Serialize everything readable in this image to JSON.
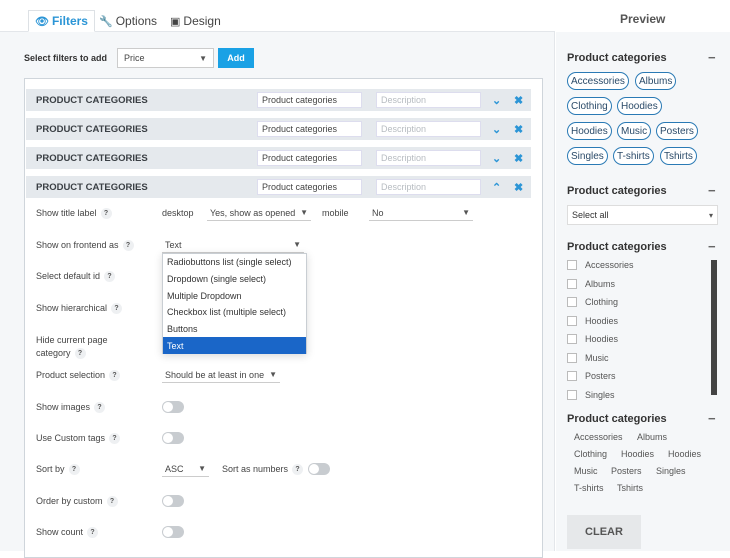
{
  "tabs": [
    {
      "label": "Filters",
      "icon": "eye-icon"
    },
    {
      "label": "Options",
      "icon": "wrench-icon"
    },
    {
      "label": "Design",
      "icon": "image-icon"
    }
  ],
  "preview_title": "Preview",
  "add_filter": {
    "label": "Select filters to add",
    "selected": "Price",
    "button": "Add"
  },
  "filters": [
    {
      "title": "PRODUCT CATEGORIES",
      "name_value": "Product categories",
      "desc_placeholder": "Description"
    },
    {
      "title": "PRODUCT CATEGORIES",
      "name_value": "Product categories",
      "desc_placeholder": "Description"
    },
    {
      "title": "PRODUCT CATEGORIES",
      "name_value": "Product categories",
      "desc_placeholder": "Description"
    },
    {
      "title": "PRODUCT CATEGORIES",
      "name_value": "Product categories",
      "desc_placeholder": "Description"
    }
  ],
  "settings": {
    "show_title_label": "Show title label",
    "desktop": "desktop",
    "desktop_value": "Yes, show as opened",
    "mobile": "mobile",
    "mobile_value": "No",
    "show_on_frontend": "Show on frontend as",
    "frontend_value": "Text",
    "select_default_id": "Select default id",
    "show_hierarchical": "Show hierarchical",
    "hide_current_1": "Hide current page",
    "hide_current_2": "category",
    "product_selection": "Product selection",
    "product_selection_value": "Should be at least in one",
    "show_images": "Show images",
    "use_custom_tags": "Use Custom tags",
    "sort_by": "Sort by",
    "sort_by_value": "ASC",
    "sort_as_numbers": "Sort as numbers",
    "order_by_custom": "Order by custom",
    "show_count": "Show count",
    "help": "?"
  },
  "frontend_options": [
    "Radiobuttons list (single select)",
    "Dropdown (single select)",
    "Multiple Dropdown",
    "Checkbox list (multiple select)",
    "Buttons",
    "Text"
  ],
  "preview": {
    "widget_title": "Product categories",
    "pills": [
      "Accessories",
      "Albums",
      "Clothing",
      "Hoodies",
      "Hoodies",
      "Music",
      "Posters",
      "Singles",
      "T-shirts",
      "Tshirts"
    ],
    "dropdown_value": "Select all",
    "checkboxes": [
      "Accessories",
      "Albums",
      "Clothing",
      "Hoodies",
      "Hoodies",
      "Music",
      "Posters",
      "Singles"
    ],
    "tags": [
      "Accessories",
      "Albums",
      "Clothing",
      "Hoodies",
      "Hoodies",
      "Music",
      "Posters",
      "Singles",
      "T-shirts",
      "Tshirts"
    ],
    "clear_button": "CLEAR"
  },
  "colors": {
    "accent": "#1aa1e5",
    "selected_option": "#1a66c8",
    "pill_border": "#2a7ab5"
  }
}
